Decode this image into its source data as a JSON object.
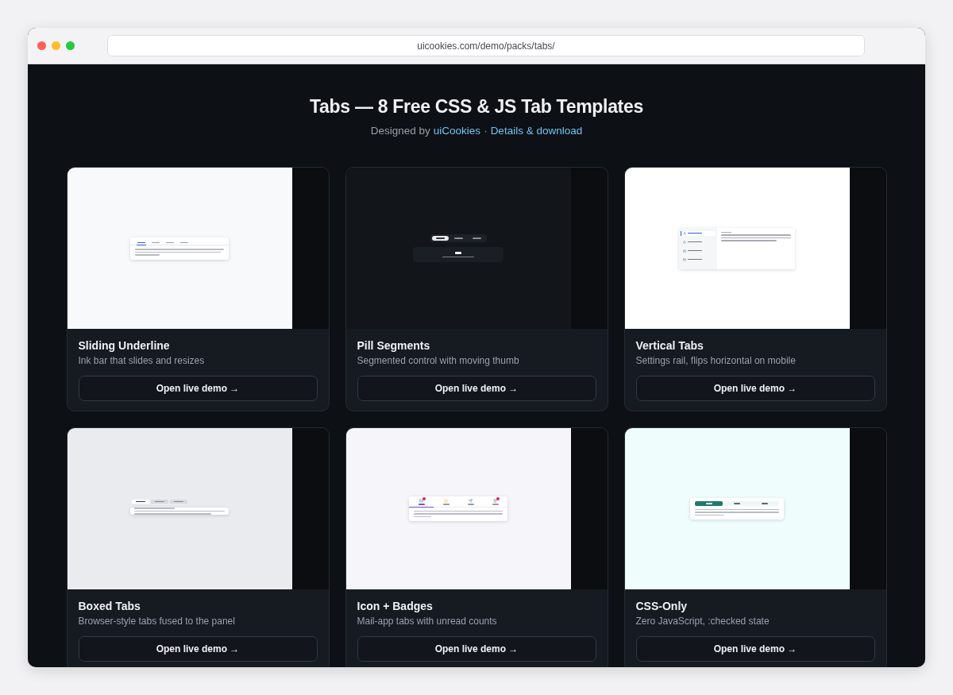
{
  "browser": {
    "url": "uicookies.com/demo/packs/tabs/"
  },
  "header": {
    "title": "Tabs — 8 Free CSS & JS Tab Templates",
    "designed_by": "Designed by",
    "author": "uiCookies",
    "separator": "·",
    "details_link": "Details & download"
  },
  "cards": [
    {
      "kind": "underline",
      "title": "Sliding Underline",
      "description": "Ink bar that slides and resizes",
      "button": "Open live demo →",
      "preview": {
        "tabs": [
          {
            "selected": true
          },
          {
            "selected": false
          },
          {
            "selected": false
          },
          {
            "selected": false
          }
        ]
      }
    },
    {
      "kind": "pill",
      "title": "Pill Segments",
      "description": "Segmented control with moving thumb",
      "button": "Open live demo →",
      "preview": {
        "tabs": [
          {
            "selected": true
          },
          {
            "selected": false
          },
          {
            "selected": false
          }
        ]
      }
    },
    {
      "kind": "vertical",
      "title": "Vertical Tabs",
      "description": "Settings rail, flips horizontal on mobile",
      "button": "Open live demo →",
      "preview": {
        "tabs": [
          {
            "selected": true
          },
          {
            "selected": false
          },
          {
            "selected": false
          },
          {
            "selected": false
          }
        ]
      }
    },
    {
      "kind": "boxed",
      "title": "Boxed Tabs",
      "description": "Browser-style tabs fused to the panel",
      "button": "Open live demo →",
      "preview": {
        "tabs": [
          {
            "selected": true
          },
          {
            "selected": false
          },
          {
            "selected": false
          }
        ]
      }
    },
    {
      "kind": "icons",
      "title": "Icon + Badges",
      "description": "Mail-app tabs with unread counts",
      "button": "Open live demo →",
      "preview": {
        "tabs": [
          {
            "selected": true,
            "badge": true
          },
          {
            "selected": false,
            "badge": false
          },
          {
            "selected": false,
            "badge": false
          },
          {
            "selected": false,
            "badge": true
          }
        ]
      }
    },
    {
      "kind": "cssonly",
      "title": "CSS-Only",
      "description": "Zero JavaScript, :checked state",
      "button": "Open live demo →",
      "preview": {
        "tabs": [
          {
            "selected": true
          },
          {
            "selected": false
          },
          {
            "selected": false
          }
        ]
      }
    }
  ]
}
